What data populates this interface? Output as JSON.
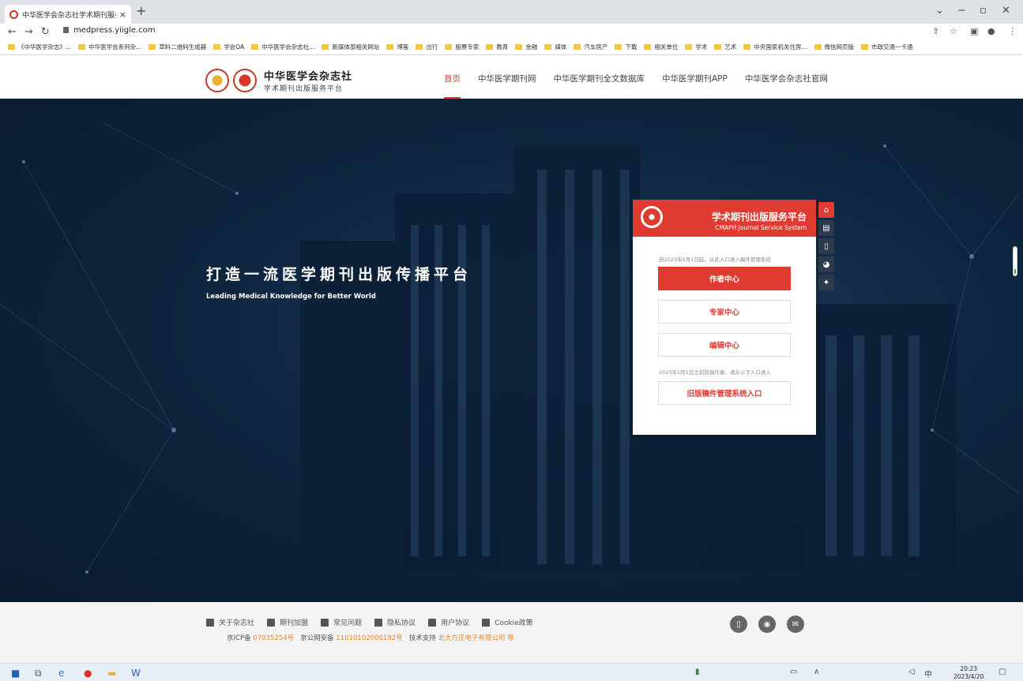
{
  "browser": {
    "tab_title": "中华医学会杂志社学术期刊服务…",
    "url": "medpress.yiigle.com"
  },
  "bookmarks": [
    "《中华医学杂志》...",
    "中华医学会系列杂...",
    "草料二维码生成器",
    "学会OA",
    "中华医学会杂志社...",
    "新媒体部相关网站",
    "博客",
    "出行",
    "股票专家",
    "教育",
    "金融",
    "媒体",
    "汽车房产",
    "下载",
    "相关单位",
    "学术",
    "艺术",
    "中央国家机关住房...",
    "微信网页版",
    "市政交通一卡通"
  ],
  "header": {
    "logo_title": "中华医学会杂志社",
    "logo_subtitle": "学术期刊出版服务平台",
    "nav": [
      "首页",
      "中华医学期刊网",
      "中华医学期刊全文数据库",
      "中华医学期刊APP",
      "中华医学会杂志社官网"
    ]
  },
  "hero": {
    "slogan": "打造一流医学期刊出版传播平台",
    "slogan_en": "Leading Medical Knowledge for Better World"
  },
  "panel": {
    "title": "学术期刊出版服务平台",
    "subtitle": "CMAPH Journal Service System",
    "notice_new": "自2023年5月1日起，从此入口进入稿件管理系统",
    "btn_author": "作者中心",
    "btn_expert": "专家中心",
    "btn_editor": "编辑中心",
    "notice_old": "2023年5月1日之前投稿作者，请从以下入口进入",
    "btn_legacy": "旧版稿件管理系统入口"
  },
  "footer": {
    "links": [
      "关于杂志社",
      "期刊加盟",
      "常见问题",
      "隐私协议",
      "用户协议",
      "Cookie政策"
    ],
    "icp_label": "京ICP备",
    "icp_num": "07035254号",
    "police_label": "京公网安备",
    "police_num": "11010102000192号",
    "support_label": "技术支持",
    "support_val": "北大方正电子有限公司 等"
  },
  "taskbar": {
    "time": "20:23",
    "date": "2023/4/20"
  }
}
